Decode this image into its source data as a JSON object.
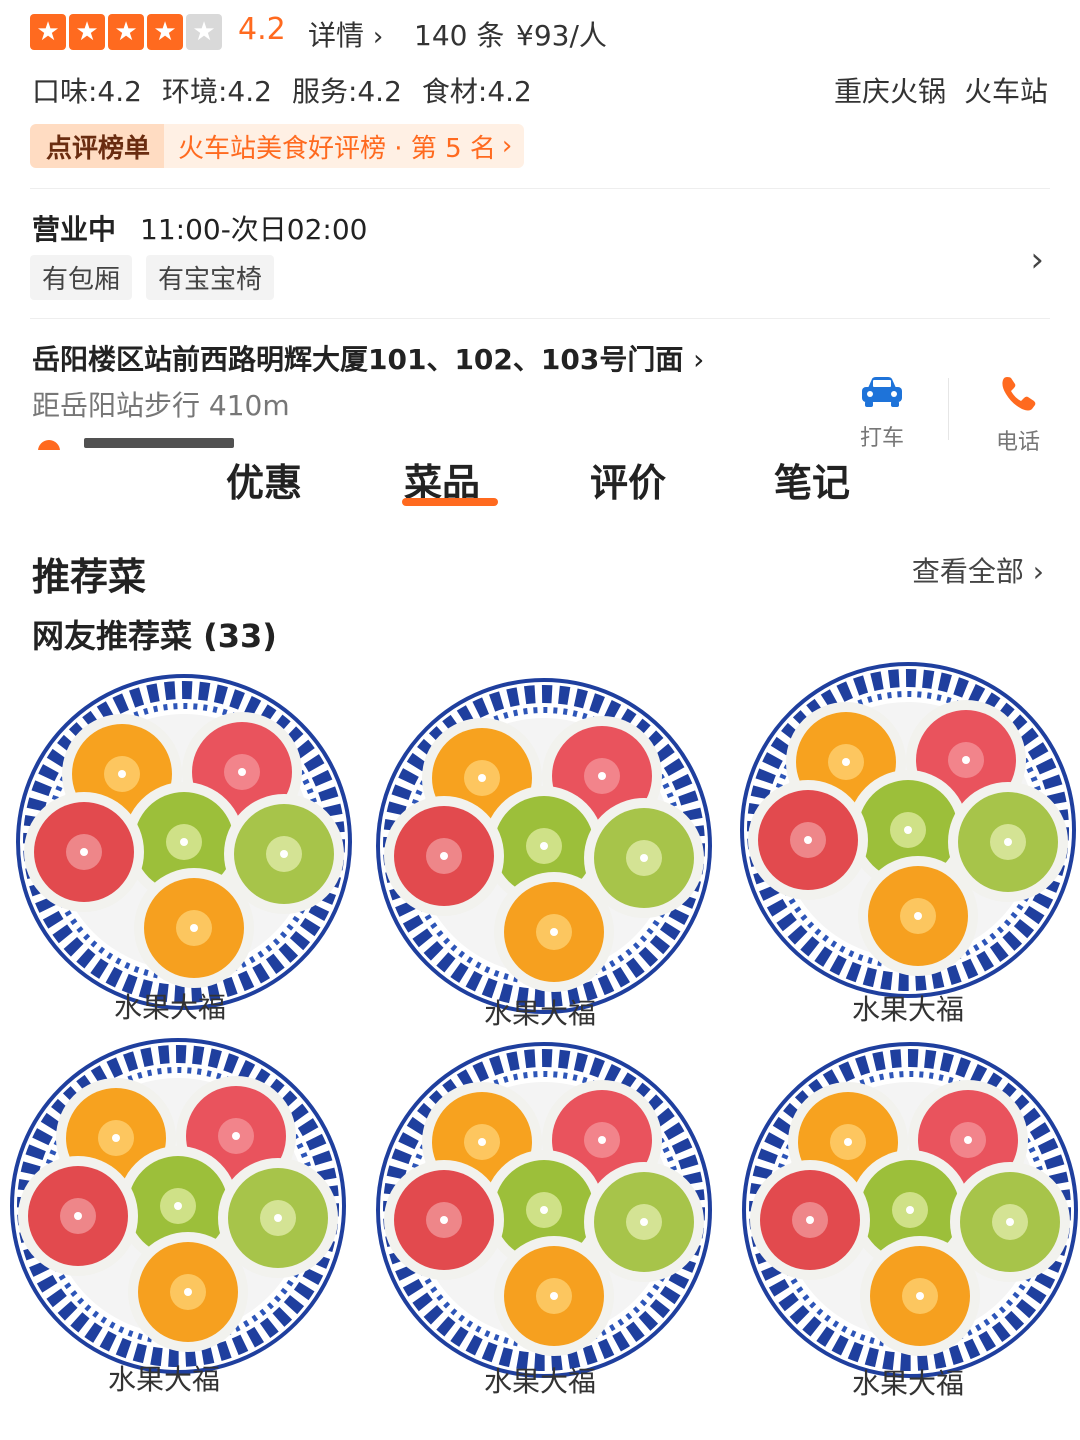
{
  "rating": {
    "stars_filled": 4,
    "stars_total": 5,
    "score": "4.2"
  },
  "top": {
    "details_link": "详情",
    "review_count": "140 条",
    "price": "¥93/人"
  },
  "scores": [
    "口味:4.2",
    "环境:4.2",
    "服务:4.2",
    "食材:4.2"
  ],
  "categories": [
    "重庆火锅",
    "火车站"
  ],
  "ranking": {
    "label": "点评榜单",
    "text": "火车站美食好评榜 · 第 5 名"
  },
  "hours": {
    "status": "营业中",
    "time": "11:00-次日02:00",
    "facilities": [
      "有包厢",
      "有宝宝椅"
    ]
  },
  "address": {
    "line": "岳阳楼区站前西路明辉大厦101、102、103号门面",
    "distance": "距岳阳站步行 410m"
  },
  "actions": {
    "taxi": "打车",
    "phone": "电话"
  },
  "tabs": [
    "优惠",
    "菜品",
    "评价",
    "笔记"
  ],
  "active_tab": "菜品",
  "section": {
    "title": "推荐菜",
    "see_all": "查看全部",
    "subtitle": "网友推荐菜 (33)"
  },
  "dishes": [
    {
      "name": "水果大福"
    },
    {
      "name": "水果大福"
    },
    {
      "name": "水果大福"
    },
    {
      "name": "水果大福"
    },
    {
      "name": "水果大福"
    },
    {
      "name": "水果大福"
    }
  ],
  "colors": {
    "accent": "#ff6a1f",
    "taxi_icon": "#1e73d9",
    "plate_blue": "#1f3f9e"
  }
}
